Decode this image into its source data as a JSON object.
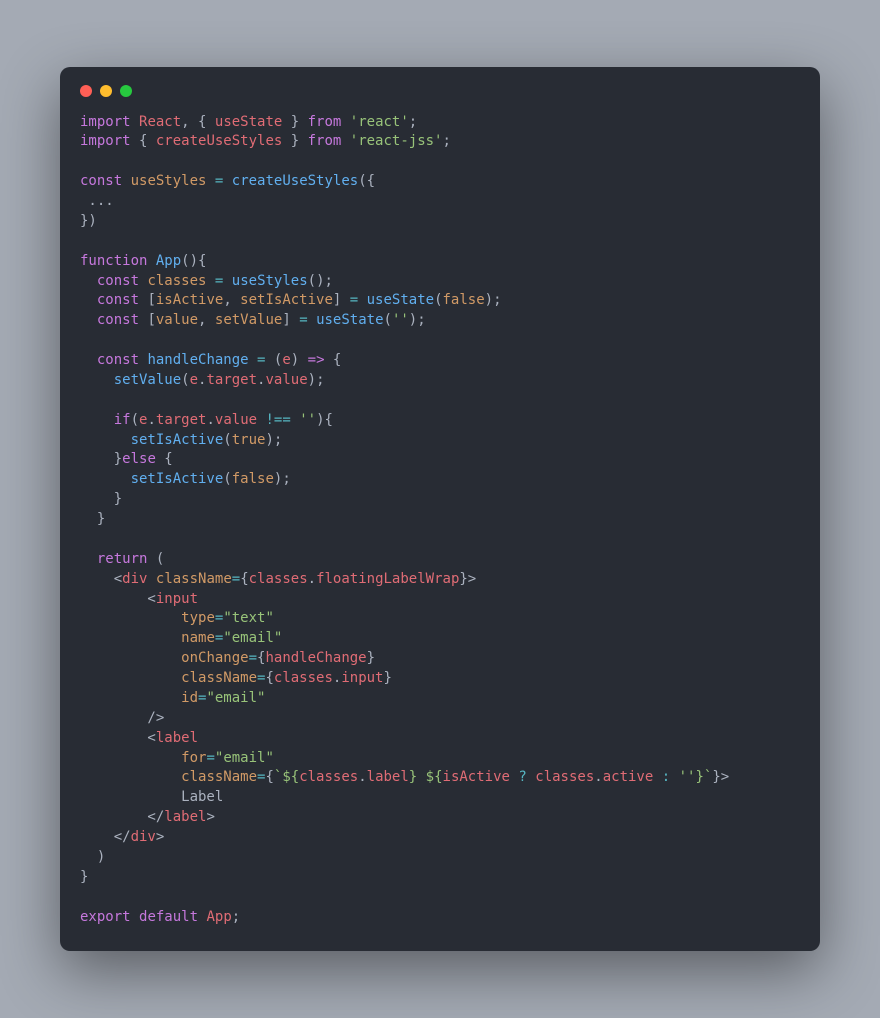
{
  "traffic_lights": [
    "red",
    "yellow",
    "green"
  ],
  "code": {
    "lines": [
      [
        [
          "kw",
          "import"
        ],
        [
          "pn",
          " "
        ],
        [
          "var",
          "React"
        ],
        [
          "pn",
          ", { "
        ],
        [
          "var",
          "useState"
        ],
        [
          "pn",
          " } "
        ],
        [
          "kw",
          "from"
        ],
        [
          "pn",
          " "
        ],
        [
          "str",
          "'react'"
        ],
        [
          "pn",
          ";"
        ]
      ],
      [
        [
          "kw",
          "import"
        ],
        [
          "pn",
          " { "
        ],
        [
          "var",
          "createUseStyles"
        ],
        [
          "pn",
          " } "
        ],
        [
          "kw",
          "from"
        ],
        [
          "pn",
          " "
        ],
        [
          "str",
          "'react-jss'"
        ],
        [
          "pn",
          ";"
        ]
      ],
      [],
      [
        [
          "kw",
          "const"
        ],
        [
          "pn",
          " "
        ],
        [
          "attr",
          "useStyles"
        ],
        [
          "pn",
          " "
        ],
        [
          "op",
          "="
        ],
        [
          "pn",
          " "
        ],
        [
          "fn",
          "createUseStyles"
        ],
        [
          "pn",
          "({"
        ]
      ],
      [
        [
          "cmt",
          " ..."
        ]
      ],
      [
        [
          "pn",
          "})"
        ]
      ],
      [],
      [
        [
          "kw",
          "function"
        ],
        [
          "pn",
          " "
        ],
        [
          "fn",
          "App"
        ],
        [
          "pn",
          "(){"
        ]
      ],
      [
        [
          "pn",
          "  "
        ],
        [
          "kw",
          "const"
        ],
        [
          "pn",
          " "
        ],
        [
          "attr",
          "classes"
        ],
        [
          "pn",
          " "
        ],
        [
          "op",
          "="
        ],
        [
          "pn",
          " "
        ],
        [
          "fn",
          "useStyles"
        ],
        [
          "pn",
          "();"
        ]
      ],
      [
        [
          "pn",
          "  "
        ],
        [
          "kw",
          "const"
        ],
        [
          "pn",
          " ["
        ],
        [
          "attr",
          "isActive"
        ],
        [
          "pn",
          ", "
        ],
        [
          "attr",
          "setIsActive"
        ],
        [
          "pn",
          "] "
        ],
        [
          "op",
          "="
        ],
        [
          "pn",
          " "
        ],
        [
          "fn",
          "useState"
        ],
        [
          "pn",
          "("
        ],
        [
          "attr",
          "false"
        ],
        [
          "pn",
          ");"
        ]
      ],
      [
        [
          "pn",
          "  "
        ],
        [
          "kw",
          "const"
        ],
        [
          "pn",
          " ["
        ],
        [
          "attr",
          "value"
        ],
        [
          "pn",
          ", "
        ],
        [
          "attr",
          "setValue"
        ],
        [
          "pn",
          "] "
        ],
        [
          "op",
          "="
        ],
        [
          "pn",
          " "
        ],
        [
          "fn",
          "useState"
        ],
        [
          "pn",
          "("
        ],
        [
          "str",
          "''"
        ],
        [
          "pn",
          ");"
        ]
      ],
      [],
      [
        [
          "pn",
          "  "
        ],
        [
          "kw",
          "const"
        ],
        [
          "pn",
          " "
        ],
        [
          "fn",
          "handleChange"
        ],
        [
          "pn",
          " "
        ],
        [
          "op",
          "="
        ],
        [
          "pn",
          " ("
        ],
        [
          "var",
          "e"
        ],
        [
          "pn",
          ") "
        ],
        [
          "kw",
          "=>"
        ],
        [
          "pn",
          " {"
        ]
      ],
      [
        [
          "pn",
          "    "
        ],
        [
          "fn",
          "setValue"
        ],
        [
          "pn",
          "("
        ],
        [
          "var",
          "e"
        ],
        [
          "pn",
          "."
        ],
        [
          "var",
          "target"
        ],
        [
          "pn",
          "."
        ],
        [
          "var",
          "value"
        ],
        [
          "pn",
          ");"
        ]
      ],
      [],
      [
        [
          "pn",
          "    "
        ],
        [
          "kw",
          "if"
        ],
        [
          "pn",
          "("
        ],
        [
          "var",
          "e"
        ],
        [
          "pn",
          "."
        ],
        [
          "var",
          "target"
        ],
        [
          "pn",
          "."
        ],
        [
          "var",
          "value"
        ],
        [
          "pn",
          " "
        ],
        [
          "op",
          "!=="
        ],
        [
          "pn",
          " "
        ],
        [
          "str",
          "''"
        ],
        [
          "pn",
          "){"
        ]
      ],
      [
        [
          "pn",
          "      "
        ],
        [
          "fn",
          "setIsActive"
        ],
        [
          "pn",
          "("
        ],
        [
          "attr",
          "true"
        ],
        [
          "pn",
          ");"
        ]
      ],
      [
        [
          "pn",
          "    }"
        ],
        [
          "kw",
          "else"
        ],
        [
          "pn",
          " {"
        ]
      ],
      [
        [
          "pn",
          "      "
        ],
        [
          "fn",
          "setIsActive"
        ],
        [
          "pn",
          "("
        ],
        [
          "attr",
          "false"
        ],
        [
          "pn",
          ");"
        ]
      ],
      [
        [
          "pn",
          "    }"
        ]
      ],
      [
        [
          "pn",
          "  }"
        ]
      ],
      [],
      [
        [
          "pn",
          "  "
        ],
        [
          "kw",
          "return"
        ],
        [
          "pn",
          " ("
        ]
      ],
      [
        [
          "pn",
          "    <"
        ],
        [
          "var",
          "div"
        ],
        [
          "pn",
          " "
        ],
        [
          "attr",
          "className"
        ],
        [
          "op",
          "="
        ],
        [
          "pn",
          "{"
        ],
        [
          "var",
          "classes"
        ],
        [
          "pn",
          "."
        ],
        [
          "var",
          "floatingLabelWrap"
        ],
        [
          "pn",
          "}>"
        ]
      ],
      [
        [
          "pn",
          "        <"
        ],
        [
          "var",
          "input"
        ]
      ],
      [
        [
          "pn",
          "            "
        ],
        [
          "attr",
          "type"
        ],
        [
          "op",
          "="
        ],
        [
          "str",
          "\"text\""
        ]
      ],
      [
        [
          "pn",
          "            "
        ],
        [
          "attr",
          "name"
        ],
        [
          "op",
          "="
        ],
        [
          "str",
          "\"email\""
        ]
      ],
      [
        [
          "pn",
          "            "
        ],
        [
          "attr",
          "onChange"
        ],
        [
          "op",
          "="
        ],
        [
          "pn",
          "{"
        ],
        [
          "var",
          "handleChange"
        ],
        [
          "pn",
          "}"
        ]
      ],
      [
        [
          "pn",
          "            "
        ],
        [
          "attr",
          "className"
        ],
        [
          "op",
          "="
        ],
        [
          "pn",
          "{"
        ],
        [
          "var",
          "classes"
        ],
        [
          "pn",
          "."
        ],
        [
          "var",
          "input"
        ],
        [
          "pn",
          "}"
        ]
      ],
      [
        [
          "pn",
          "            "
        ],
        [
          "attr",
          "id"
        ],
        [
          "op",
          "="
        ],
        [
          "str",
          "\"email\""
        ]
      ],
      [
        [
          "pn",
          "        />"
        ]
      ],
      [
        [
          "pn",
          "        <"
        ],
        [
          "var",
          "label"
        ]
      ],
      [
        [
          "pn",
          "            "
        ],
        [
          "attr",
          "for"
        ],
        [
          "op",
          "="
        ],
        [
          "str",
          "\"email\""
        ]
      ],
      [
        [
          "pn",
          "            "
        ],
        [
          "attr",
          "className"
        ],
        [
          "op",
          "="
        ],
        [
          "pn",
          "{"
        ],
        [
          "str",
          "`${"
        ],
        [
          "var",
          "classes"
        ],
        [
          "pn",
          "."
        ],
        [
          "var",
          "label"
        ],
        [
          "str",
          "} ${"
        ],
        [
          "var",
          "isActive"
        ],
        [
          "pn",
          " "
        ],
        [
          "op",
          "?"
        ],
        [
          "pn",
          " "
        ],
        [
          "var",
          "classes"
        ],
        [
          "pn",
          "."
        ],
        [
          "var",
          "active"
        ],
        [
          "pn",
          " "
        ],
        [
          "op",
          ":"
        ],
        [
          "pn",
          " "
        ],
        [
          "str",
          "''"
        ],
        [
          "str",
          "}`"
        ],
        [
          "pn",
          "}>"
        ]
      ],
      [
        [
          "pn",
          "            Label"
        ]
      ],
      [
        [
          "pn",
          "        </"
        ],
        [
          "var",
          "label"
        ],
        [
          "pn",
          ">"
        ]
      ],
      [
        [
          "pn",
          "    </"
        ],
        [
          "var",
          "div"
        ],
        [
          "pn",
          ">"
        ]
      ],
      [
        [
          "pn",
          "  )"
        ]
      ],
      [
        [
          "pn",
          "}"
        ]
      ],
      [],
      [
        [
          "kw",
          "export"
        ],
        [
          "pn",
          " "
        ],
        [
          "kw",
          "default"
        ],
        [
          "pn",
          " "
        ],
        [
          "var",
          "App"
        ],
        [
          "pn",
          ";"
        ]
      ]
    ]
  }
}
